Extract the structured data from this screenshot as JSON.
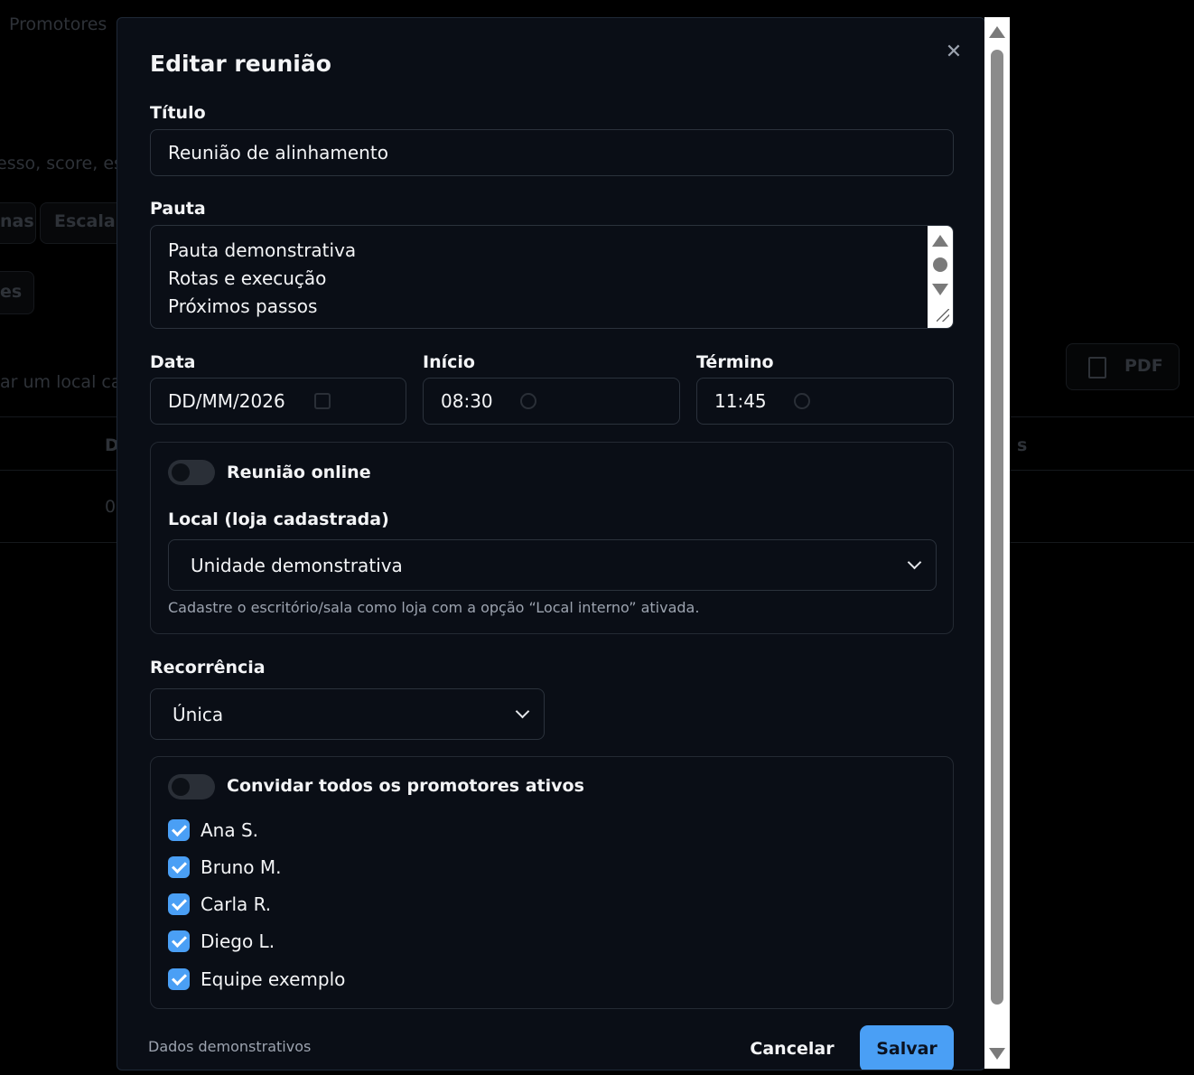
{
  "background": {
    "nav_label": "Promotores",
    "search_hint": "esso, score, es",
    "tab_1": "nas",
    "tab_2": "Escala d",
    "filter_button": "es",
    "location_hint": "ar um local cav",
    "pdf_label": "PDF",
    "column_1": "D",
    "column_2": "s",
    "cell_1": "0"
  },
  "modal": {
    "title": "Editar reunião",
    "close_icon": "close-icon",
    "titulo": {
      "label": "Título",
      "value": "Reunião de alinhamento"
    },
    "pauta": {
      "label": "Pauta",
      "lines": [
        "Pauta demonstrativa",
        "Rotas e execução",
        "Próximos passos"
      ]
    },
    "data": {
      "label": "Data",
      "value": "DD/MM/2026"
    },
    "inicio": {
      "label": "Início",
      "value": "08:30"
    },
    "termino": {
      "label": "Término",
      "value": "11:45"
    },
    "online": {
      "label": "Reunião online",
      "enabled": false
    },
    "local": {
      "label": "Local (loja cadastrada)",
      "selected": "Unidade demonstrativa",
      "hint": "Cadastre o escritório/sala como loja com a opção “Local interno” ativada."
    },
    "recorrencia": {
      "label": "Recorrência",
      "selected": "Única"
    },
    "invite_all": {
      "label": "Convidar todos os promotores ativos",
      "enabled": false
    },
    "participants": [
      {
        "name": "Ana S.",
        "checked": true
      },
      {
        "name": "Bruno M.",
        "checked": true
      },
      {
        "name": "Carla R.",
        "checked": true
      },
      {
        "name": "Diego L.",
        "checked": true
      },
      {
        "name": "Equipe exemplo",
        "checked": true
      }
    ],
    "footer_note": "Dados demonstrativos",
    "cancel_label": "Cancelar",
    "save_label": "Salvar"
  },
  "colors": {
    "accent": "#4a9ff5",
    "modal_bg": "#0a0e16",
    "border": "#2b323c"
  }
}
